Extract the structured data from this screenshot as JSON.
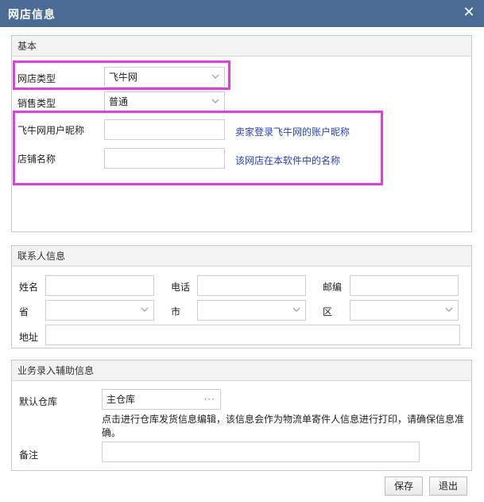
{
  "window": {
    "title": "网店信息",
    "close_icon": "close-icon"
  },
  "basic": {
    "header": "基本",
    "shop_type_label": "网店类型",
    "shop_type_value": "飞牛网",
    "sales_type_label": "销售类型",
    "sales_type_value": "普通",
    "nickname_label": "飞牛网用户昵称",
    "nickname_value": "",
    "nickname_hint": "卖家登录飞牛网的账户昵称",
    "shop_name_label": "店铺名称",
    "shop_name_value": "",
    "shop_name_hint": "该网店在本软件中的名称"
  },
  "contact": {
    "header": "联系人信息",
    "name_label": "姓名",
    "phone_label": "电话",
    "postcode_label": "邮编",
    "province_label": "省",
    "city_label": "市",
    "district_label": "区",
    "address_label": "地址"
  },
  "business": {
    "header": "业务录入辅助信息",
    "warehouse_label": "默认仓库",
    "warehouse_value": "主仓库",
    "warehouse_more": "···",
    "note_line1": "点击进行仓库发货信息编辑，该信息会作为物流单寄件人信息进行打印，请确保信息准",
    "note_line2": "确。",
    "remark_label": "备注"
  },
  "footer": {
    "save_label": "保存",
    "exit_label": "退出"
  },
  "colors": {
    "titlebar": "#4a6b94",
    "highlight": "#e13ee1",
    "hint": "#2a3fcc"
  }
}
